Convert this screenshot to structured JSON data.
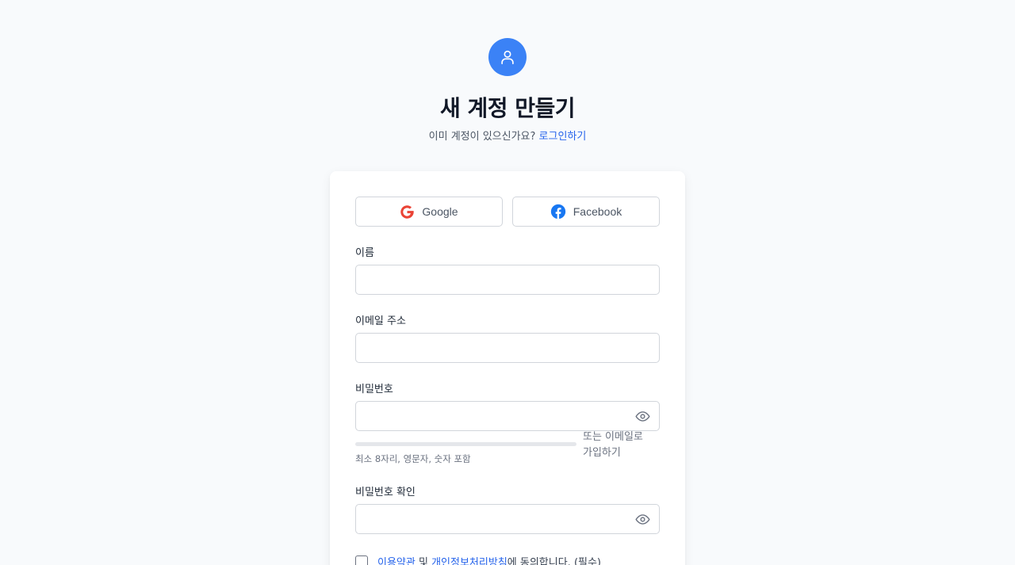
{
  "header": {
    "title": "새 계정 만들기",
    "subtitle_prefix": "이미 계정이 있으신가요?",
    "login_link": "로그인하기",
    "accent_color": "#3b82f6",
    "avatar_icon": "user-icon"
  },
  "social": {
    "google_label": "Google",
    "facebook_label": "Facebook"
  },
  "form": {
    "name_label": "이름",
    "name_value": "",
    "email_label": "이메일 주소",
    "email_value": "",
    "password_label": "비밀번호",
    "password_value": "",
    "password_strength": 0,
    "divider_text": "또는 이메일로 가입하기",
    "password_hint": "최소 8자리, 영문자, 숫자 포함",
    "confirm_label": "비밀번호 확인",
    "confirm_value": "",
    "show_password_icon": "eye-icon"
  },
  "terms": {
    "checked": false,
    "terms_link": "이용약관",
    "and": "및",
    "privacy_link": "개인정보처리방침",
    "suffix": "에 동의합니다. (필수)"
  }
}
